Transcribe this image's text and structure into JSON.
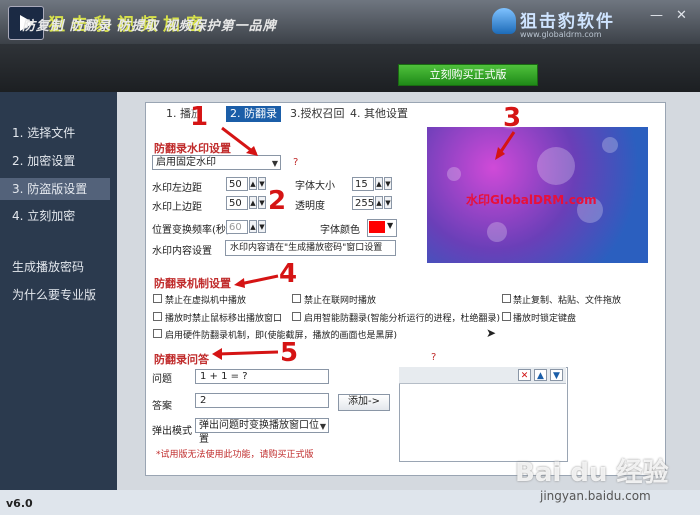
{
  "app": {
    "title": "狙击豹视频加密",
    "version": "v6.0"
  },
  "brand": {
    "name": "狙击豹软件",
    "url": "www.globaldrm.com"
  },
  "window_controls": {
    "minimize": "—",
    "close": "✕"
  },
  "banner": {
    "slogan": "防复制  防翻录  防提取  视频保护第一品牌",
    "buy_button": "立刻购买正式版"
  },
  "sidebar": {
    "items": [
      {
        "label": "1. 选择文件",
        "active": false
      },
      {
        "label": "2. 加密设置",
        "active": false
      },
      {
        "label": "3. 防盗版设置",
        "active": true
      },
      {
        "label": "4. 立刻加密",
        "active": false
      },
      {
        "label": "生成播放密码",
        "active": false
      },
      {
        "label": "为什么要专业版",
        "active": false
      }
    ]
  },
  "tabs": [
    {
      "label": "1. 播放",
      "active": false
    },
    {
      "label": "2. 防翻录",
      "active": true
    },
    {
      "label": "3.授权召回",
      "active": false
    },
    {
      "label": "4. 其他设置",
      "active": false
    }
  ],
  "watermark_section": {
    "title": "防翻录水印设置",
    "mode_select": "启用固定水印",
    "left_margin_label": "水印左边距",
    "left_margin_value": "50",
    "top_margin_label": "水印上边距",
    "top_margin_value": "50",
    "font_size_label": "字体大小",
    "font_size_value": "15",
    "opacity_label": "透明度",
    "opacity_value": "255",
    "position_freq_label": "位置变换频率(秒)",
    "position_freq_value": "60",
    "font_color_label": "字体颜色",
    "font_color": "#ff0000",
    "content_label": "水印内容设置",
    "content_value": "水印内容请在\"生成播放密码\"窗口设置",
    "required_marker": "?"
  },
  "preview": {
    "watermark_text": "水印GlobalDRM.com"
  },
  "mechanism_section": {
    "title": "防翻录机制设置",
    "options": [
      "禁止在虚拟机中播放",
      "禁止在联网时播放",
      "禁止复制、粘贴、文件拖放",
      "播放时禁止鼠标移出播放窗口",
      "启用智能防翻录(智能分析运行的进程，杜绝翻录)",
      "播放时锁定键盘",
      "启用硬件防翻录机制，即(使能截屏，播放的画面也是黑屏)"
    ]
  },
  "qa_section": {
    "title": "防翻录问答",
    "question_label": "问题",
    "question_value": "1 + 1 = ?",
    "answer_label": "答案",
    "answer_value": "2",
    "add_button": "添加->",
    "popup_label": "弹出模式",
    "popup_value": "弹出问题时变换播放窗口位置",
    "notice": "*试用版无法使用此功能，请购买正式版",
    "list_marker": "?"
  },
  "list_toolbar": {
    "delete": "✕",
    "up": "▲",
    "down": "▼"
  },
  "annotations": [
    "1",
    "2",
    "3",
    "4",
    "5"
  ],
  "watermark_overlay": {
    "logo": "Bai du 经验",
    "url": "jingyan.baidu.com"
  }
}
